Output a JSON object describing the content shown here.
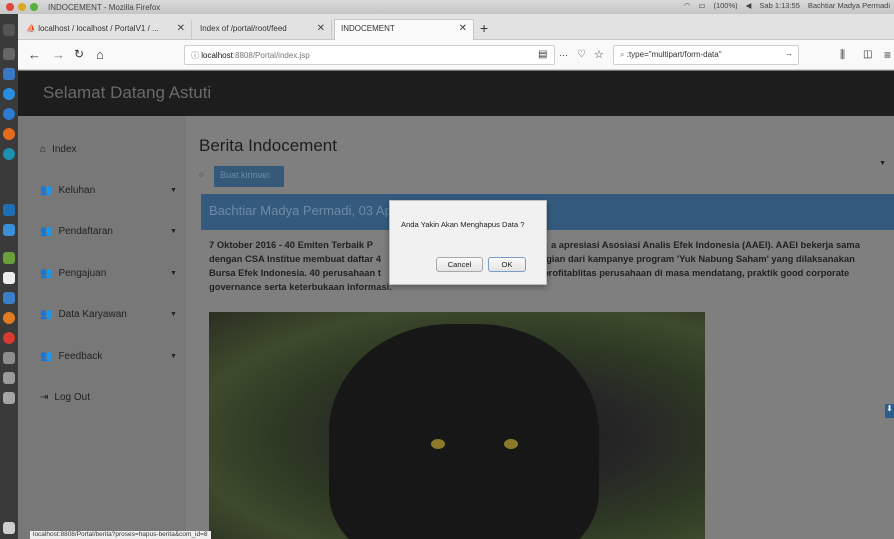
{
  "os": {
    "window_title": "INDOCEMENT - Mozilla Firefox",
    "status": {
      "battery": "(100%)",
      "clock": "Sab 1:13:55",
      "user": "Bachtiar Madya Permadi"
    }
  },
  "browser": {
    "tabs": [
      {
        "label": "localhost / localhost / PortalV1 / ..."
      },
      {
        "label": "Index of /portal/root/feed"
      },
      {
        "label": "INDOCEMENT"
      }
    ],
    "url_host": "localhost",
    "url_path": ":8808/Portal/index.jsp",
    "search_value": ":type=\"multipart/form-data\"",
    "status_url": "localhost:8808/Portal/berita?proses=hapus-berita&com_id=8"
  },
  "site": {
    "brand": "Selamat Datang Astuti",
    "sidebar": [
      {
        "label": "Index",
        "icon": "home-icon",
        "caret": false
      },
      {
        "label": "Keluhan",
        "icon": "users-icon",
        "caret": true
      },
      {
        "label": "Pendaftaran",
        "icon": "users-icon",
        "caret": true
      },
      {
        "label": "Pengajuan",
        "icon": "users-icon",
        "caret": true
      },
      {
        "label": "Data Karyawan",
        "icon": "users-icon",
        "caret": true
      },
      {
        "label": "Feedback",
        "icon": "users-icon",
        "caret": true
      },
      {
        "label": "Log Out",
        "icon": "logout-icon",
        "caret": false
      }
    ],
    "page_title": "Berita Indocement",
    "create_button": "Buat kiriman",
    "post": {
      "header": "Bachtiar Madya Permadi, 03 Apr",
      "text_left": "7 Oktober 2016 - 40 Emiten Terbaik P",
      "text_right": "a apresiasi Asosiasi Analis Efek Indonesia (AAEI). AAEI bekerja sama",
      "line2_left": "dengan CSA Institue membuat daftar 4",
      "line2_right": "gian dari kampanye program 'Yuk Nabung Saham' yang dilaksanakan",
      "line3_left": "Bursa Efek Indonesia. 40 perusahaan t",
      "line3_right": "profitablitas perusahaan di masa mendatang, praktik good corporate",
      "line4": "governance serta keterbukaan informasi."
    }
  },
  "dialog": {
    "message": "Anda Yakin Akan Menghapus Data ?",
    "cancel": "Cancel",
    "ok": "OK"
  },
  "colors": {
    "navbar": "#1d1d1d",
    "accent": "#345b7d"
  }
}
